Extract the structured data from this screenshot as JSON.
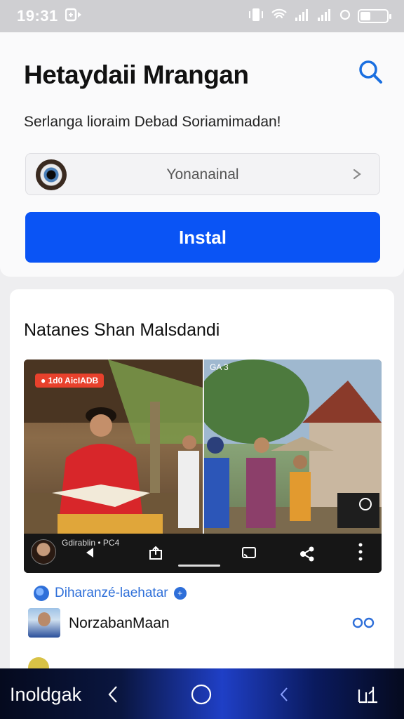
{
  "status_bar": {
    "time": "19:31",
    "battery_level": 0.4
  },
  "header": {
    "title": "Hetaydaii Mrangan",
    "subtitle": "Serlanga lioraim Debad Soriamimadan!",
    "selector_value": "Yonanainal",
    "install_label": "Instal"
  },
  "section": {
    "title": "Natanes Shan Malsdandi",
    "media": {
      "live_badge": "● 1d0 AicIADB",
      "cam_label": "GA 3",
      "overlay_name": "Gdirablin • PC4"
    },
    "uploader": "Diharanzé-laehatar",
    "author": "NorzabanMaan"
  },
  "nav_bar": {
    "label": "Inoldgak"
  },
  "colors": {
    "accent": "#0a54f5",
    "link": "#2e6fd9",
    "live": "#e8412c"
  },
  "icons": [
    "search-icon",
    "chevron-down-icon",
    "back-icon",
    "share-icon",
    "cast-icon",
    "nodes-icon",
    "more-vertical-icon",
    "link-icon",
    "home-circle-icon",
    "recents-icon"
  ]
}
